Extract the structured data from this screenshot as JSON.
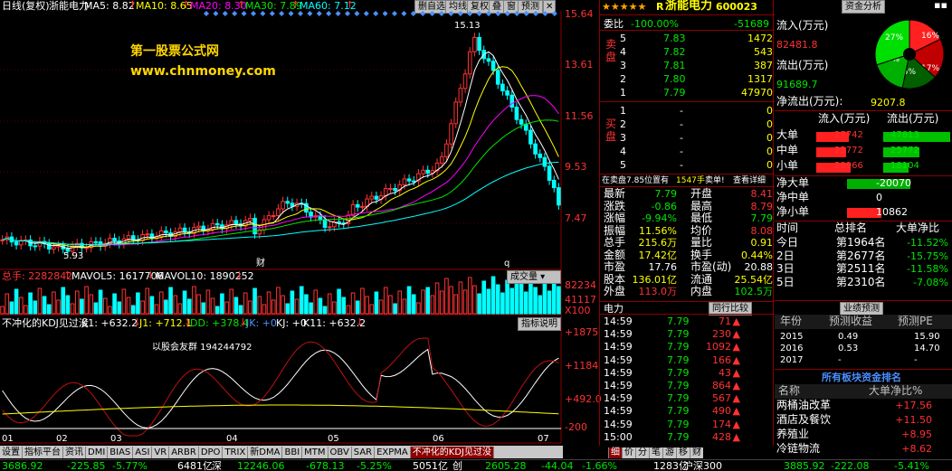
{
  "top": {
    "period": "日线(复权)",
    "stock": "浙能电力",
    "ma5": "MA5: 8.82",
    "ma10": "MA10: 8.65",
    "ma20": "MA20: 8.30",
    "ma30": "MA30: 7.89",
    "ma60": "MA60: 7.12",
    "buttons": [
      "删自选",
      "均线",
      "复权",
      "叠",
      "窗",
      "预测"
    ]
  },
  "watermark": {
    "line1": "第一股票公式网",
    "line2": "www.chnmoney.com"
  },
  "price_axis": [
    "15.64",
    "13.61",
    "11.56",
    "9.53",
    "7.47"
  ],
  "annotations": {
    "high": "15.13",
    "low": "5.93",
    "cai": "财",
    "q": "q"
  },
  "volume": {
    "label": "总手: 2282842",
    "mavol5": "MAVOL5: 1617706",
    "mavol10": "MAVOL10: 1890252",
    "button": "成交量",
    "axis": [
      "82234",
      "41117",
      "X100"
    ]
  },
  "kdj": {
    "title": "不冲化的KDJ见过没",
    "k1": "K1: +632.2",
    "j1": "J1: +712.1",
    "dd": "DD: +378.4",
    "jk": "JK: +0",
    "kj": "KJ: +0",
    "k11": "K11: +632.2",
    "button": "指标说明",
    "axis": [
      "+1875",
      "+1184",
      "+492.0",
      "-200"
    ],
    "note": "以股会友群 194244792"
  },
  "xaxis": [
    "01",
    "02",
    "03",
    "04",
    "05",
    "06",
    "07"
  ],
  "tabs": [
    "设置",
    "指标平台",
    "资讯",
    "DMI",
    "BIAS",
    "ASI",
    "VR",
    "ARBR",
    "DPO",
    "TRIX",
    "新DMA",
    "BBI",
    "MTM",
    "OBV",
    "SAR",
    "EXPMA",
    "不冲化的KDJ见过没"
  ],
  "right_tabs": [
    "细",
    "价",
    "分",
    "笔",
    "游",
    "移",
    "财"
  ],
  "status": {
    "sh_index": "3686.92",
    "sh_chg": "-225.85",
    "sh_pct": "-5.77%",
    "sh_amt": "6481亿",
    "sz_label": "深",
    "sz_index": "12246.06",
    "sz_chg": "-678.13",
    "sz_pct": "-5.25%",
    "sz_amt": "5051亿",
    "cy_label": "创",
    "cy_index": "2605.28",
    "cy_chg": "-44.04",
    "cy_pct": "-1.66%",
    "hs_amt": "1283亿",
    "hs_label": "沪深300",
    "hs_index": "3885.92",
    "hs_chg": "-222.08",
    "hs_pct": "-5.41%"
  },
  "quote": {
    "stars": "★★★★★",
    "r": "R",
    "name": "浙能电力",
    "code": "600023",
    "webi_label": "委比",
    "webi": "-100.00%",
    "webi_diff": "-51689",
    "sell_label": "卖盘",
    "buy_label": "买盘",
    "sell": [
      {
        "n": "5",
        "p": "7.83",
        "v": "1472"
      },
      {
        "n": "4",
        "p": "7.82",
        "v": "543"
      },
      {
        "n": "3",
        "p": "7.81",
        "v": "387"
      },
      {
        "n": "2",
        "p": "7.80",
        "v": "1317"
      },
      {
        "n": "1",
        "p": "7.79",
        "v": "47970"
      }
    ],
    "buy": [
      {
        "n": "1",
        "p": "-",
        "v": "0"
      },
      {
        "n": "2",
        "p": "-",
        "v": "0"
      },
      {
        "n": "3",
        "p": "-",
        "v": "0"
      },
      {
        "n": "4",
        "p": "-",
        "v": "0"
      },
      {
        "n": "5",
        "p": "-",
        "v": "0"
      }
    ],
    "info": {
      "a": "在卖盘7.85位置有",
      "b": "1547手",
      "c": "卖单!",
      "d": "查看详细"
    },
    "stats": [
      [
        "最新",
        "7.79",
        "开盘",
        "8.41"
      ],
      [
        "涨跌",
        "-0.86",
        "最高",
        "8.79"
      ],
      [
        "涨幅",
        "-9.94%",
        "最低",
        "7.79"
      ],
      [
        "振幅",
        "11.56%",
        "均价",
        "8.08"
      ],
      [
        "总手",
        "215.6万",
        "量比",
        "0.91"
      ],
      [
        "金额",
        "17.42亿",
        "换手",
        "0.44%"
      ],
      [
        "市盈",
        "17.76",
        "市盈(动)",
        "20.88"
      ],
      [
        "股本",
        "136.01亿",
        "流通",
        "25.54亿"
      ],
      [
        "外盘",
        "113.0万",
        "内盘",
        "102.5万"
      ]
    ],
    "trade_header": {
      "a": "电力",
      "b": "同行比较"
    },
    "trades": [
      [
        "14:59",
        "7.79",
        "71"
      ],
      [
        "14:59",
        "7.79",
        "230"
      ],
      [
        "14:59",
        "7.79",
        "1092"
      ],
      [
        "14:59",
        "7.79",
        "166"
      ],
      [
        "14:59",
        "7.79",
        "43"
      ],
      [
        "14:59",
        "7.79",
        "864"
      ],
      [
        "14:59",
        "7.79",
        "567"
      ],
      [
        "14:59",
        "7.79",
        "490"
      ],
      [
        "14:59",
        "7.79",
        "174"
      ],
      [
        "15:00",
        "7.79",
        "428"
      ]
    ]
  },
  "fund": {
    "title": "资金分析",
    "inflow_label": "流入(万元)",
    "inflow": "82481.8",
    "outflow_label": "流出(万元)",
    "outflow": "91689.7",
    "net_label": "净流出(万元):",
    "net": "9207.8",
    "pie": [
      {
        "label": "16%",
        "color": "#ff2020"
      },
      {
        "label": "17%",
        "color": "#c00000"
      },
      {
        "label": "15%",
        "color": "#006000"
      },
      {
        "label": "15%",
        "color": "#00b000"
      },
      {
        "label": "27%",
        "color": "#00e000"
      }
    ],
    "hdr_in": "流入(万元)",
    "hdr_out": "流出(万元)",
    "rows": [
      {
        "name": "大单",
        "in": "27742",
        "out": "47813",
        "inf": 0.58,
        "outf": 1.0
      },
      {
        "name": "中单",
        "in": "25772",
        "out": "25772",
        "inf": 0.54,
        "outf": 0.54
      },
      {
        "name": "小单",
        "in": "28966",
        "out": "18104",
        "inf": 0.61,
        "outf": 0.38
      }
    ],
    "nets": [
      {
        "name": "净大单",
        "val": "-20070",
        "color": "#00b000",
        "frac": 1.0
      },
      {
        "name": "净中单",
        "val": "0",
        "color": "#000",
        "frac": 0
      },
      {
        "name": "净小单",
        "val": "10862",
        "color": "#ff2020",
        "frac": 0.54
      }
    ],
    "rank_hdr": [
      "时间",
      "总排名",
      "大单净比"
    ],
    "rank": [
      [
        "今日",
        "第1964名",
        "-11.52%"
      ],
      [
        "2日",
        "第2677名",
        "-15.75%"
      ],
      [
        "3日",
        "第2511名",
        "-11.58%"
      ],
      [
        "5日",
        "第2310名",
        "-7.08%"
      ]
    ]
  },
  "forecast": {
    "title": "业绩预测",
    "hdr": [
      "年份",
      "预测收益",
      "预测PE"
    ],
    "rows": [
      [
        "2015",
        "0.49",
        "15.90"
      ],
      [
        "2016",
        "0.53",
        "14.70"
      ],
      [
        "2017",
        "-",
        "-"
      ]
    ]
  },
  "sector": {
    "title": "所有板块资金排名",
    "hdr": [
      "名称",
      "大单净比%"
    ],
    "rows": [
      [
        "两桶油改革",
        "+17.56"
      ],
      [
        "酒店及餐饮",
        "+11.50"
      ],
      [
        "养殖业",
        "+8.95"
      ],
      [
        "冷链物流",
        "+8.62"
      ]
    ]
  },
  "colors": {
    "up": "#ff3232",
    "down": "#00ffff",
    "grid": "#8b0000",
    "yellow": "#ffff00"
  }
}
